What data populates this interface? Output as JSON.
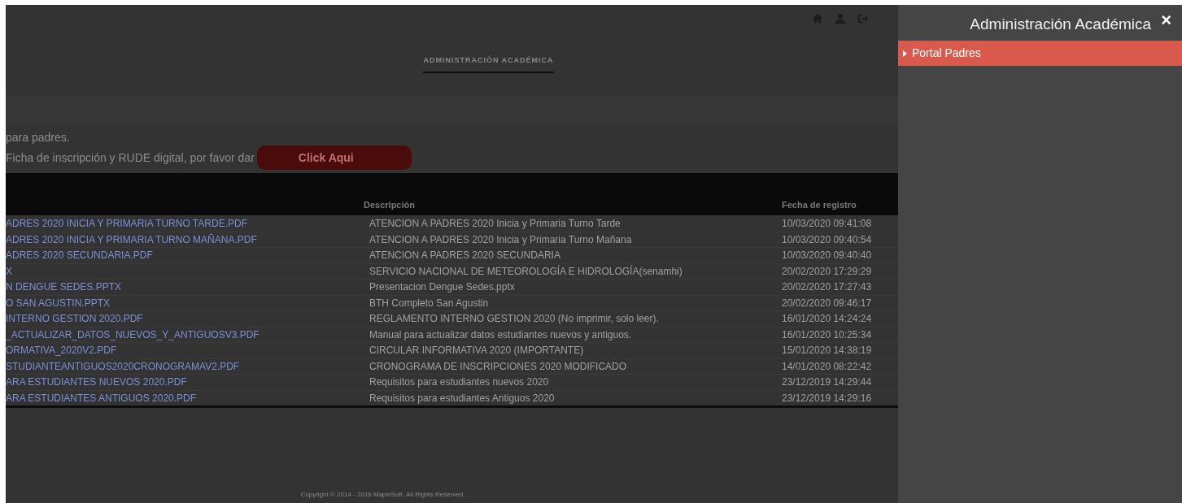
{
  "header": {
    "nav_title": "ADMINISTRACIÓN ACADÉMICA"
  },
  "notice": {
    "line_1": "para padres.",
    "line_2": "Ficha de inscripción y RUDE digital, por favor dar",
    "button": "Click Aqui"
  },
  "table": {
    "columns": [
      "Descripción",
      "Fecha de registro"
    ],
    "rows": [
      {
        "file": "ADRES 2020 INICIA Y PRIMARIA TURNO TARDE.PDF",
        "description": "ATENCION A PADRES 2020 Inicia y Primaria Turno Tarde",
        "date": "10/03/2020 09:41:08"
      },
      {
        "file": "ADRES 2020 INICIA Y PRIMARIA TURNO MAÑANA.PDF",
        "description": "ATENCION A PADRES 2020 Inicia y Primaria Turno Mañana",
        "date": "10/03/2020 09:40:54"
      },
      {
        "file": "ADRES 2020 SECUNDARIA.PDF",
        "description": "ATENCION A PADRES 2020 SECUNDARIA",
        "date": "10/03/2020 09:40:40"
      },
      {
        "file": "X",
        "description": "SERVICIO NACIONAL DE METEOROLOGÍA E HIDROLOGÍA(senamhi)",
        "date": "20/02/2020 17:29:29"
      },
      {
        "file": "N DENGUE SEDES.PPTX",
        "description": "Presentacion Dengue Sedes.pptx",
        "date": "20/02/2020 17:27:43"
      },
      {
        "file": "O SAN AGUSTIN.PPTX",
        "description": "BTH Completo San Agustin",
        "date": "20/02/2020 09:46:17"
      },
      {
        "file": "INTERNO GESTION 2020.PDF",
        "description": "REGLAMENTO INTERNO GESTION 2020 (No imprimir, solo leer).",
        "date": "16/01/2020 14:24:24"
      },
      {
        "file": "_ACTUALIZAR_DATOS_NUEVOS_Y_ANTIGUOSV3.PDF",
        "description": "Manual para actualizar datos estudiantes nuevos y antiguos.",
        "date": "16/01/2020 10:25:34"
      },
      {
        "file": "ORMATIVA_2020V2.PDF",
        "description": "CIRCULAR INFORMATIVA 2020 (IMPORTANTE)",
        "date": "15/01/2020 14:38:19"
      },
      {
        "file": "STUDIANTEANTIGUOS2020CRONOGRAMAV2.PDF",
        "description": "CRONOGRAMA DE INSCRIPCIONES 2020 MODIFICADO",
        "date": "14/01/2020 08:22:42"
      },
      {
        "file": "ARA ESTUDIANTES NUEVOS 2020.PDF",
        "description": "Requisitos para estudiantes nuevos 2020",
        "date": "23/12/2019 14:29:44"
      },
      {
        "file": "ARA ESTUDIANTES ANTIGUOS 2020.PDF",
        "description": "Requisitos para estudiantes Antiguos 2020",
        "date": "23/12/2019 14:29:16"
      }
    ]
  },
  "footer": "Copyright © 2014 - 2016 MapiriSoft. All Rights Reserved.",
  "side_panel": {
    "title": "Administración Académica",
    "close": "×",
    "items": [
      {
        "label": "Portal Padres",
        "selected": true
      }
    ]
  }
}
